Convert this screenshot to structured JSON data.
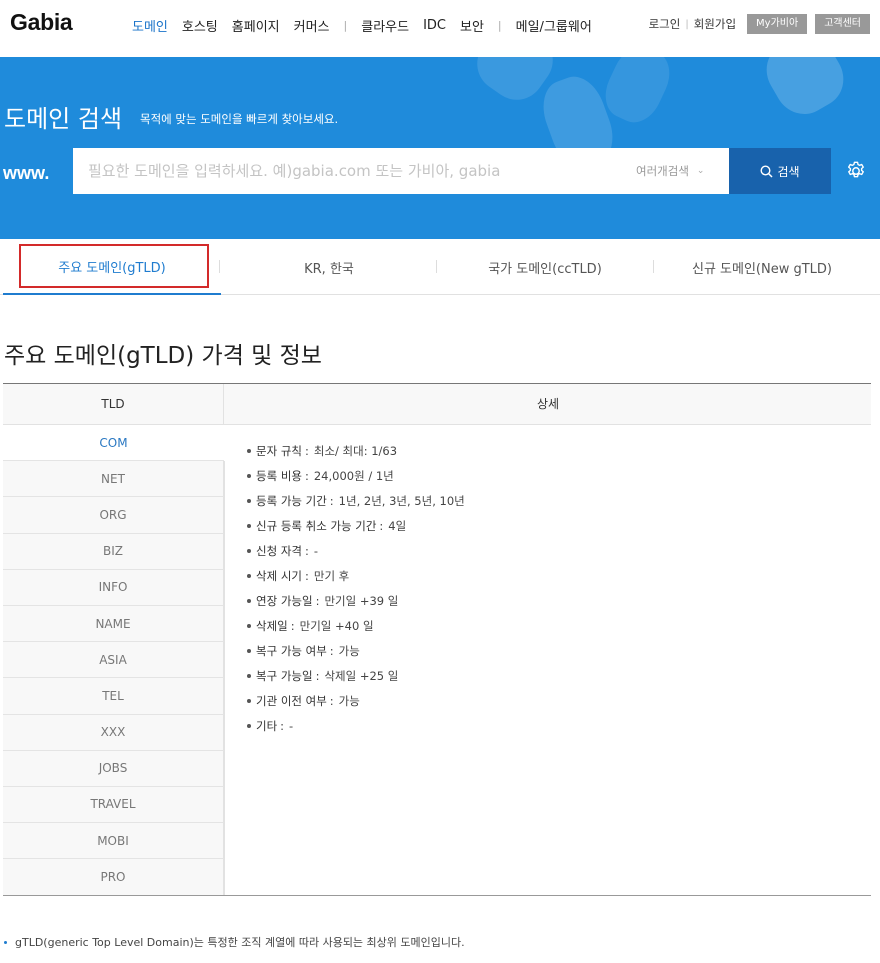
{
  "header": {
    "logo": "Gabia",
    "nav": [
      {
        "label": "도메인",
        "active": true
      },
      {
        "label": "호스팅"
      },
      {
        "label": "홈페이지"
      },
      {
        "label": "커머스"
      },
      {
        "sep": "|"
      },
      {
        "label": "클라우드"
      },
      {
        "label": "IDC"
      },
      {
        "label": "보안"
      },
      {
        "sep": "|"
      },
      {
        "label": "메일/그룹웨어"
      }
    ],
    "login": "로그인",
    "signup": "회원가입",
    "my_gabia": "My가비아",
    "support": "고객센터"
  },
  "hero": {
    "title": "도메인 검색",
    "subtitle": "목적에 맞는 도메인을 빠르게 찾아보세요.",
    "prefix": "www.",
    "search_placeholder": "필요한 도메인을 입력하세요. 예)gabia.com 또는 가비아, gabia",
    "multi_search": "여러개검색",
    "search_button": "검색",
    "background_color": "#1f8bdb",
    "button_color": "#1862ac"
  },
  "tabs": [
    {
      "label": "주요 도메인(gTLD)",
      "active": true
    },
    {
      "label": "KR, 한국"
    },
    {
      "label": "국가 도메인(ccTLD)"
    },
    {
      "label": "신규 도메인(New gTLD)"
    }
  ],
  "section": {
    "title": "주요 도메인(gTLD) 가격 및 정보"
  },
  "table": {
    "col_tld": "TLD",
    "col_detail": "상세",
    "tlds": [
      "COM",
      "NET",
      "ORG",
      "BIZ",
      "INFO",
      "NAME",
      "ASIA",
      "TEL",
      "XXX",
      "JOBS",
      "TRAVEL",
      "MOBI",
      "PRO"
    ],
    "selected": "COM",
    "details": [
      {
        "label": "문자 규칙",
        "value": "최소/ 최대: 1/63"
      },
      {
        "label": "등록 비용",
        "value": "24,000원 / 1년"
      },
      {
        "label": "등록 가능 기간",
        "value": "1년, 2년, 3년, 5년, 10년"
      },
      {
        "label": "신규 등록 취소 가능 기간",
        "value": "4일"
      },
      {
        "label": "신청 자격",
        "value": "-"
      },
      {
        "label": "삭제 시기",
        "value": "만기 후"
      },
      {
        "label": "연장 가능일",
        "value": "만기일 +39 일"
      },
      {
        "label": "삭제일",
        "value": "만기일 +40 일"
      },
      {
        "label": "복구 가능 여부",
        "value": "가능"
      },
      {
        "label": "복구 가능일",
        "value": "삭제일 +25 일"
      },
      {
        "label": "기관 이전 여부",
        "value": "가능"
      },
      {
        "label": "기타",
        "value": "-"
      }
    ]
  },
  "footnote": "gTLD(generic Top Level Domain)는 특정한 조직 계열에 따라 사용되는 최상위 도메인입니다."
}
